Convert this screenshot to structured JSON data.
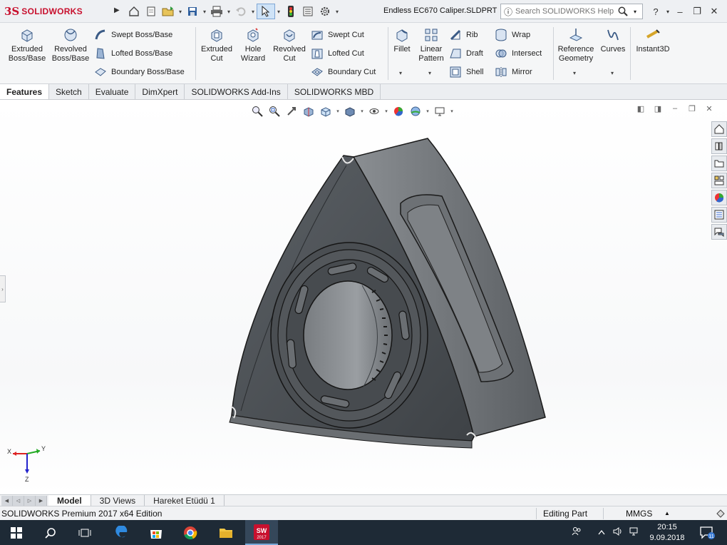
{
  "app": {
    "logo_prefix": "3S",
    "logo_text": "SOLIDWORKS",
    "document_title": "Endless EC670 Caliper.SLDPRT"
  },
  "search": {
    "placeholder": "Search SOLIDWORKS Help"
  },
  "ribbon": {
    "extruded_boss": "Extruded Boss/Base",
    "revolved_boss": "Revolved Boss/Base",
    "swept_boss": "Swept Boss/Base",
    "lofted_boss": "Lofted Boss/Base",
    "boundary_boss": "Boundary Boss/Base",
    "extruded_cut": "Extruded Cut",
    "hole_wizard": "Hole Wizard",
    "revolved_cut": "Revolved Cut",
    "swept_cut": "Swept Cut",
    "lofted_cut": "Lofted Cut",
    "boundary_cut": "Boundary Cut",
    "fillet": "Fillet",
    "linear_pattern": "Linear Pattern",
    "rib": "Rib",
    "draft": "Draft",
    "shell": "Shell",
    "wrap": "Wrap",
    "intersect": "Intersect",
    "mirror": "Mirror",
    "reference_geometry": "Reference Geometry",
    "curves": "Curves",
    "instant3d": "Instant3D"
  },
  "command_tabs": [
    "Features",
    "Sketch",
    "Evaluate",
    "DimXpert",
    "SOLIDWORKS Add-Ins",
    "SOLIDWORKS MBD"
  ],
  "bottom_tabs": [
    "Model",
    "3D Views",
    "Hareket Etüdü 1"
  ],
  "status": {
    "product": "SOLIDWORKS Premium 2017 x64 Edition",
    "mode": "Editing Part",
    "units": "MMGS"
  },
  "triad": {
    "x": "X",
    "y": "Y",
    "z": "Z"
  },
  "taskbar": {
    "sw_badge": "SW",
    "sw_year": "2017",
    "time": "20:15",
    "date": "9.09.2018",
    "notification_count": "11"
  },
  "colors": {
    "brand_red": "#c8102e",
    "taskbar": "#1e2a36",
    "model_dark": "#4f5357"
  }
}
